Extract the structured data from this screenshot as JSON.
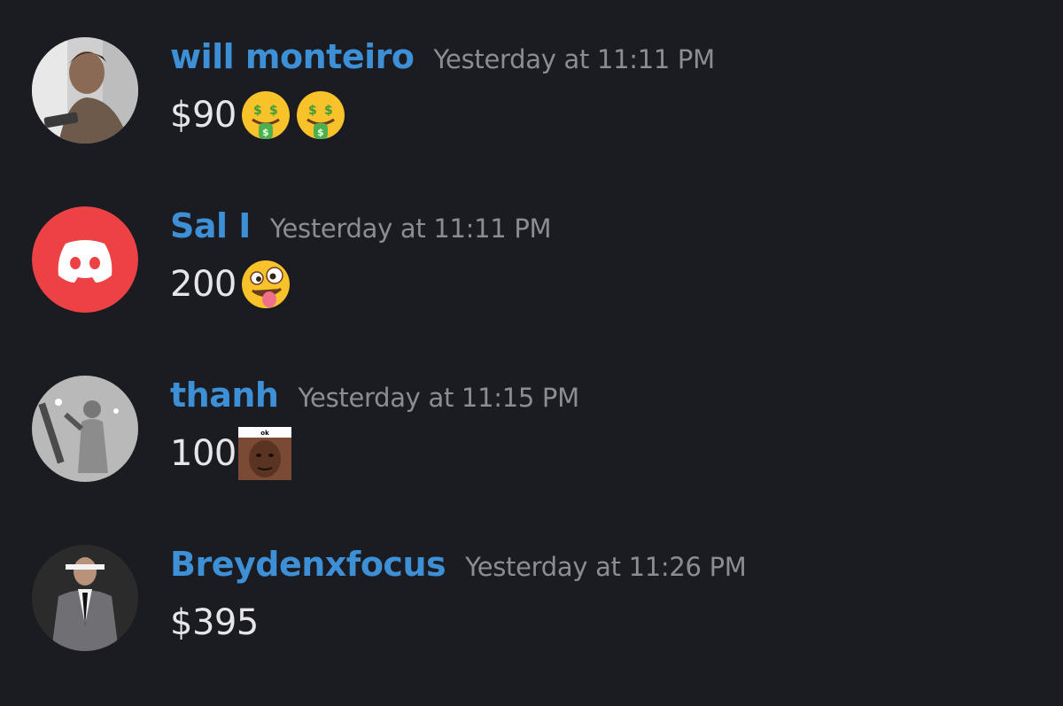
{
  "messages": [
    {
      "username": "will monteiro",
      "timestamp": "Yesterday at 11:11 PM",
      "text": "$90",
      "emojis": [
        "money-mouth-face",
        "money-mouth-face"
      ],
      "avatar": "photo-person"
    },
    {
      "username": "Sal I",
      "timestamp": "Yesterday at 11:11 PM",
      "text": "200",
      "emojis": [
        "zany-face"
      ],
      "avatar": "discord-default",
      "avatar_color": "#ed4245"
    },
    {
      "username": "thanh",
      "timestamp": "Yesterday at 11:15 PM",
      "text": "100",
      "emojis": [
        "ok-face-sticker"
      ],
      "sticker_caption": "ok",
      "avatar": "sketch-art"
    },
    {
      "username": "Breydenxfocus",
      "timestamp": "Yesterday at 11:26 PM",
      "text": "$395",
      "emojis": [],
      "avatar": "photo-suit"
    }
  ],
  "colors": {
    "background": "#1b1c21",
    "username": "#3d8fd6",
    "timestamp": "#8a8d94",
    "message_text": "#e6e6ea"
  }
}
